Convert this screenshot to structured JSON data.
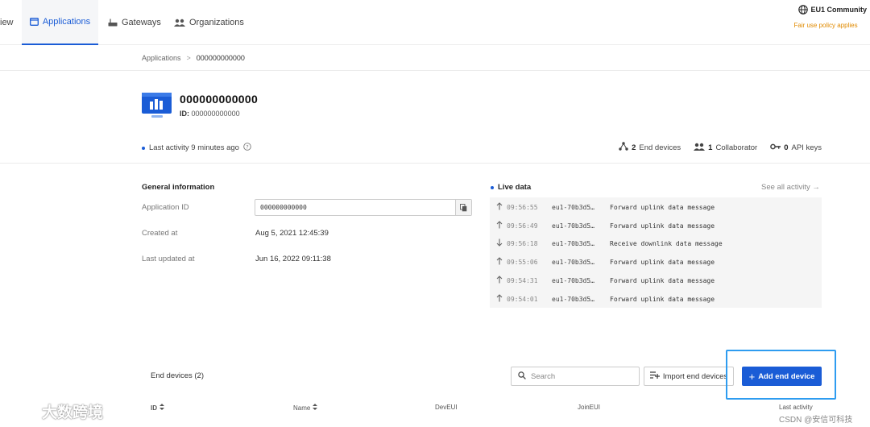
{
  "nav": {
    "overview_fragment": "iew",
    "tabs": [
      {
        "label": "Applications",
        "icon": "app-icon"
      },
      {
        "label": "Gateways",
        "icon": "gateway-icon"
      },
      {
        "label": "Organizations",
        "icon": "organizations-icon"
      }
    ],
    "region": {
      "label": "EU1 Community",
      "note": "Fair use policy applies"
    }
  },
  "breadcrumb": {
    "root": "Applications",
    "separator": ">",
    "current": "000000000000"
  },
  "app": {
    "title": "000000000000",
    "id_label": "ID:",
    "id_value": "000000000000",
    "last_activity": "Last activity 9 minutes ago",
    "stats": {
      "end_devices_count": "2",
      "end_devices_label": "End devices",
      "collaborators_count": "1",
      "collaborators_label": "Collaborator",
      "api_keys_count": "0",
      "api_keys_label": "API keys"
    }
  },
  "general": {
    "title": "General information",
    "app_id_label": "Application ID",
    "app_id_value": "000000000000",
    "created_label": "Created at",
    "created_value": "Aug 5, 2021 12:45:39",
    "updated_label": "Last updated at",
    "updated_value": "Jun 16, 2022 09:11:38"
  },
  "live": {
    "title": "Live data",
    "see_all": "See all activity →",
    "rows": [
      {
        "direction": "up",
        "time": "09:56:55",
        "device": "eu1-70b3d5…",
        "message": "Forward uplink data message"
      },
      {
        "direction": "up",
        "time": "09:56:49",
        "device": "eu1-70b3d5…",
        "message": "Forward uplink data message"
      },
      {
        "direction": "down",
        "time": "09:56:18",
        "device": "eu1-70b3d5…",
        "message": "Receive downlink data message"
      },
      {
        "direction": "up",
        "time": "09:55:06",
        "device": "eu1-70b3d5…",
        "message": "Forward uplink data message"
      },
      {
        "direction": "up",
        "time": "09:54:31",
        "device": "eu1-70b3d5…",
        "message": "Forward uplink data message"
      },
      {
        "direction": "up",
        "time": "09:54:01",
        "device": "eu1-70b3d5…",
        "message": "Forward uplink data message"
      }
    ]
  },
  "devices": {
    "title": "End devices (2)",
    "search_placeholder": "Search",
    "import_label": "Import end devices",
    "add_label": "Add end device",
    "columns": [
      "ID",
      "Name",
      "DevEUI",
      "JoinEUI",
      "Last activity"
    ]
  },
  "watermarks": {
    "left": "大数跨境",
    "right": "CSDN @安信可科技"
  },
  "colors": {
    "accent": "#1a5cd6",
    "warning": "#e08a00",
    "highlight": "#2e9cf0"
  }
}
